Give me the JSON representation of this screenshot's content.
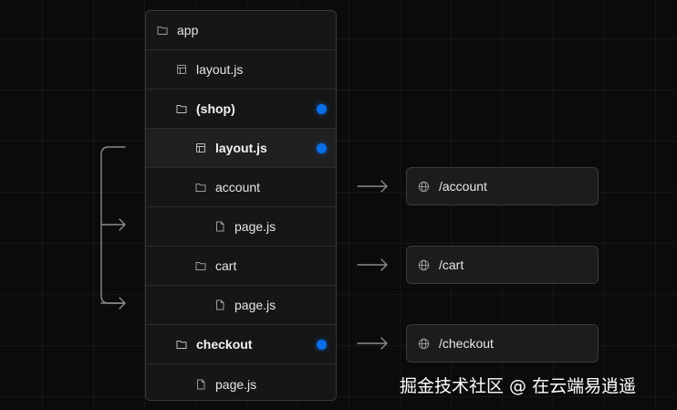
{
  "tree": {
    "rows": [
      {
        "label": "app",
        "icon": "folder-icon",
        "bold": false,
        "marked": false
      },
      {
        "label": "layout.js",
        "icon": "layout-file-icon",
        "bold": false,
        "marked": false
      },
      {
        "label": "(shop)",
        "icon": "folder-icon",
        "bold": true,
        "marked": true
      },
      {
        "label": "layout.js",
        "icon": "layout-file-icon",
        "bold": true,
        "marked": true
      },
      {
        "label": "account",
        "icon": "folder-icon",
        "bold": false,
        "marked": false
      },
      {
        "label": "page.js",
        "icon": "file-icon",
        "bold": false,
        "marked": false
      },
      {
        "label": "cart",
        "icon": "folder-icon",
        "bold": false,
        "marked": false
      },
      {
        "label": "page.js",
        "icon": "file-icon",
        "bold": false,
        "marked": false
      },
      {
        "label": "checkout",
        "icon": "folder-icon",
        "bold": true,
        "marked": true
      },
      {
        "label": "page.js",
        "icon": "file-icon",
        "bold": false,
        "marked": false
      }
    ]
  },
  "routes": [
    {
      "path": "/account",
      "icon": "globe-icon"
    },
    {
      "path": "/cart",
      "icon": "globe-icon"
    },
    {
      "path": "/checkout",
      "icon": "globe-icon"
    }
  ],
  "colors": {
    "marker": "#0a6ee8",
    "background": "#0b0b0b",
    "panel": "#161616",
    "border": "#3a3a3a",
    "arrow": "#8a8a8a"
  },
  "watermark": {
    "text": "掘金技术社区 @ 在云端易逍遥"
  }
}
